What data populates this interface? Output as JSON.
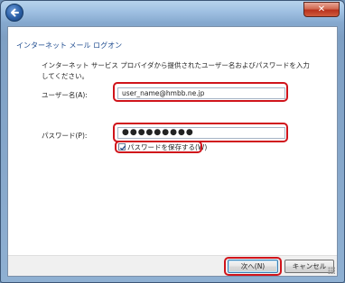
{
  "window": {
    "close_glyph": "✕"
  },
  "heading": "インターネット メール ログオン",
  "description": "インターネット サービス プロバイダから提供されたユーザー名およびパスワードを入力してください。",
  "fields": {
    "username": {
      "label": "ユーザー名(A):",
      "value": "user_name@hmbb.ne.jp"
    },
    "password": {
      "label": "パスワード(P):",
      "value": "●●●●●●●●●"
    }
  },
  "remember_password": {
    "label": "パスワードを保存する(W)",
    "checked": true
  },
  "buttons": {
    "next": "次へ(N)",
    "cancel": "キャンセル"
  },
  "highlight_color": "#d0141b",
  "heading_color": "#1e4b8f"
}
